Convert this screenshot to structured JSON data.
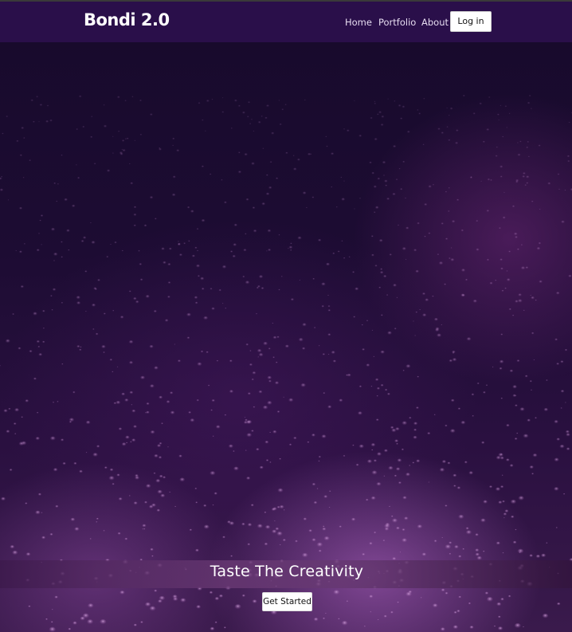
{
  "navbar": {
    "brand": "Bondi 2.0",
    "links": [
      {
        "label": "Home"
      },
      {
        "label": "Portfolio"
      },
      {
        "label": "About"
      }
    ],
    "login_label": "Log in"
  },
  "hero": {
    "tagline": "Taste The Creativity",
    "cta_label": "Get Started",
    "background": "raindrops-on-glass-photo"
  },
  "colors": {
    "navbar_bg": "#2a0f4a",
    "hero_tint": "#3a1a4c",
    "button_bg": "#ffffff"
  }
}
